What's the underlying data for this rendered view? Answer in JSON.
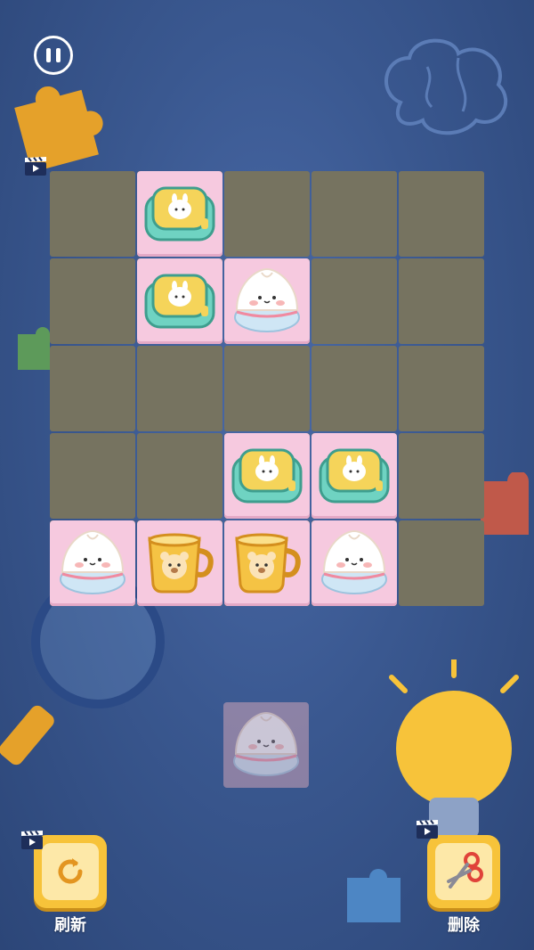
{
  "game": {
    "board": {
      "rows": 5,
      "cols": 5,
      "tiles": [
        {
          "row": 0,
          "col": 1,
          "type": "lunchbox"
        },
        {
          "row": 1,
          "col": 1,
          "type": "lunchbox"
        },
        {
          "row": 1,
          "col": 2,
          "type": "bun"
        },
        {
          "row": 3,
          "col": 2,
          "type": "lunchbox"
        },
        {
          "row": 3,
          "col": 3,
          "type": "lunchbox"
        },
        {
          "row": 4,
          "col": 0,
          "type": "bun"
        },
        {
          "row": 4,
          "col": 1,
          "type": "cup"
        },
        {
          "row": 4,
          "col": 2,
          "type": "cup"
        },
        {
          "row": 4,
          "col": 3,
          "type": "bun"
        }
      ]
    },
    "hint_tile": {
      "type": "bun"
    },
    "icons": {
      "pause": "pause-icon",
      "refresh": "refresh-icon",
      "delete": "scissors-icon",
      "video": "video-clapper-icon"
    }
  },
  "tools": {
    "refresh_label": "刷新",
    "delete_label": "删除"
  },
  "colors": {
    "background": "#3a5890",
    "empty_cell": "#767360",
    "tile": "#f6c9df",
    "button": "#f7c33a"
  }
}
